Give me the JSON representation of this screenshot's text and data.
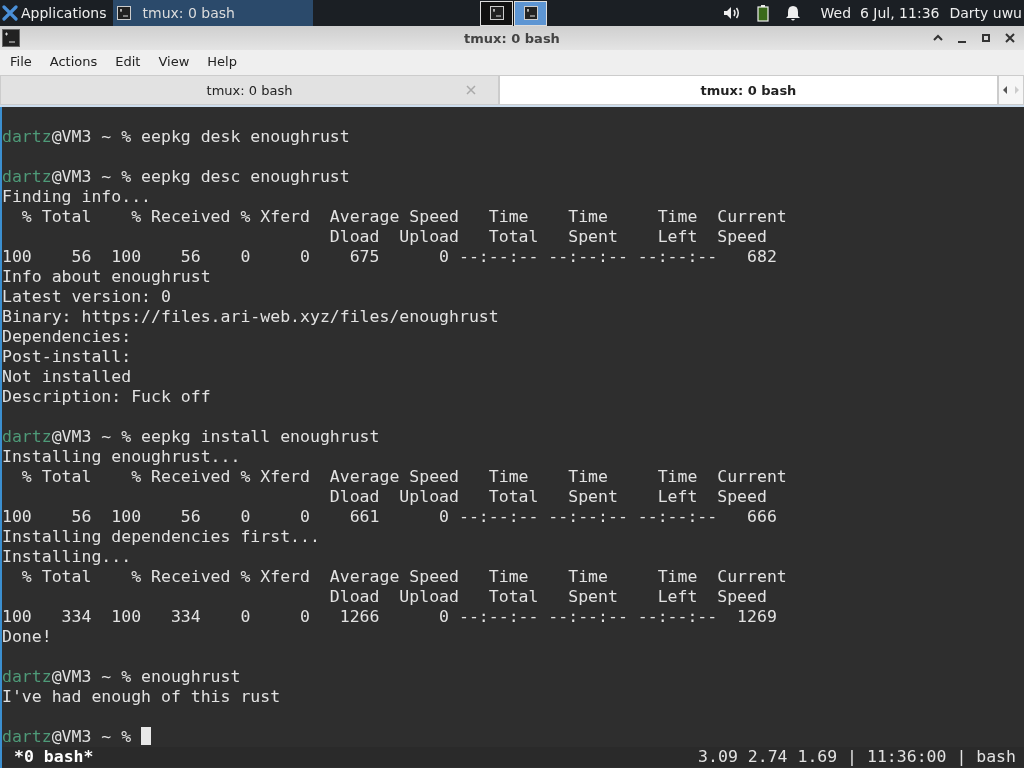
{
  "panel": {
    "menu_label": "Applications",
    "tasks": [
      {
        "label": "tmux: 0 bash",
        "selected": true
      }
    ],
    "workspaces": [
      {
        "selected": false
      },
      {
        "selected": true
      }
    ],
    "clock": "Wed  6 Jul, 11:36",
    "user": "Darty uwu"
  },
  "window": {
    "title": "tmux: 0 bash"
  },
  "menu": [
    "File",
    "Actions",
    "Edit",
    "View",
    "Help"
  ],
  "tabs": [
    {
      "label": "tmux: 0 bash",
      "selected": false
    },
    {
      "label": "tmux: 0 bash",
      "selected": true
    }
  ],
  "terminal": {
    "lines": [
      {
        "kind": "blank"
      },
      {
        "kind": "prompt",
        "user": "dartz",
        "host": "@VM3 ~ % ",
        "command": "eepkg desk enoughrust"
      },
      {
        "kind": "blank"
      },
      {
        "kind": "prompt",
        "user": "dartz",
        "host": "@VM3 ~ % ",
        "command": "eepkg desc enoughrust"
      },
      {
        "kind": "output",
        "text": "Finding info..."
      },
      {
        "kind": "output",
        "text": "  % Total    % Received % Xferd  Average Speed   Time    Time     Time  Current"
      },
      {
        "kind": "output",
        "text": "                                 Dload  Upload   Total   Spent    Left  Speed"
      },
      {
        "kind": "output",
        "text": "100    56  100    56    0     0    675      0 --:--:-- --:--:-- --:--:--   682"
      },
      {
        "kind": "output",
        "text": "Info about enoughrust"
      },
      {
        "kind": "output",
        "text": "Latest version: 0"
      },
      {
        "kind": "output",
        "text": "Binary: https://files.ari-web.xyz/files/enoughrust"
      },
      {
        "kind": "output",
        "text": "Dependencies:"
      },
      {
        "kind": "output",
        "text": "Post-install:"
      },
      {
        "kind": "output",
        "text": "Not installed"
      },
      {
        "kind": "output",
        "text": "Description: Fuck off"
      },
      {
        "kind": "blank"
      },
      {
        "kind": "prompt",
        "user": "dartz",
        "host": "@VM3 ~ % ",
        "command": "eepkg install enoughrust"
      },
      {
        "kind": "output",
        "text": "Installing enoughrust..."
      },
      {
        "kind": "output",
        "text": "  % Total    % Received % Xferd  Average Speed   Time    Time     Time  Current"
      },
      {
        "kind": "output",
        "text": "                                 Dload  Upload   Total   Spent    Left  Speed"
      },
      {
        "kind": "output",
        "text": "100    56  100    56    0     0    661      0 --:--:-- --:--:-- --:--:--   666"
      },
      {
        "kind": "output",
        "text": "Installing dependencies first..."
      },
      {
        "kind": "output",
        "text": "Installing..."
      },
      {
        "kind": "output",
        "text": "  % Total    % Received % Xferd  Average Speed   Time    Time     Time  Current"
      },
      {
        "kind": "output",
        "text": "                                 Dload  Upload   Total   Spent    Left  Speed"
      },
      {
        "kind": "output",
        "text": "100   334  100   334    0     0   1266      0 --:--:-- --:--:-- --:--:--  1269"
      },
      {
        "kind": "output",
        "text": "Done!"
      },
      {
        "kind": "blank"
      },
      {
        "kind": "prompt",
        "user": "dartz",
        "host": "@VM3 ~ % ",
        "command": "enoughrust"
      },
      {
        "kind": "output",
        "text": "I've had enough of this rust"
      },
      {
        "kind": "blank"
      },
      {
        "kind": "prompt",
        "user": "dartz",
        "host": "@VM3 ~ % ",
        "cursor": true
      }
    ],
    "status_left": "*0 bash*",
    "status_right": "3.09 2.74 1.69 | 11:36:00 | bash"
  }
}
